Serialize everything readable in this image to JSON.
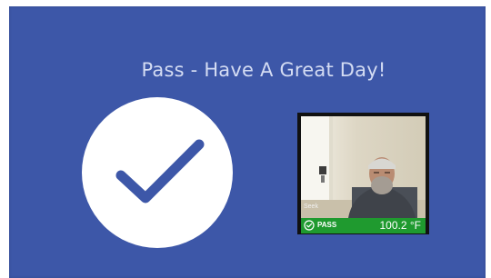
{
  "message": {
    "title": "Pass - Have A Great Day!"
  },
  "result_icon": {
    "name": "check-icon",
    "color": "#3d57a8",
    "background": "#ffffff"
  },
  "camera": {
    "brand_label": "Seek",
    "status_label": "PASS",
    "temperature": "100.2 °F",
    "status_color": "#1f9a2f"
  },
  "colors": {
    "screen_background": "#3d57a8",
    "title_text": "#d4dcf3"
  }
}
